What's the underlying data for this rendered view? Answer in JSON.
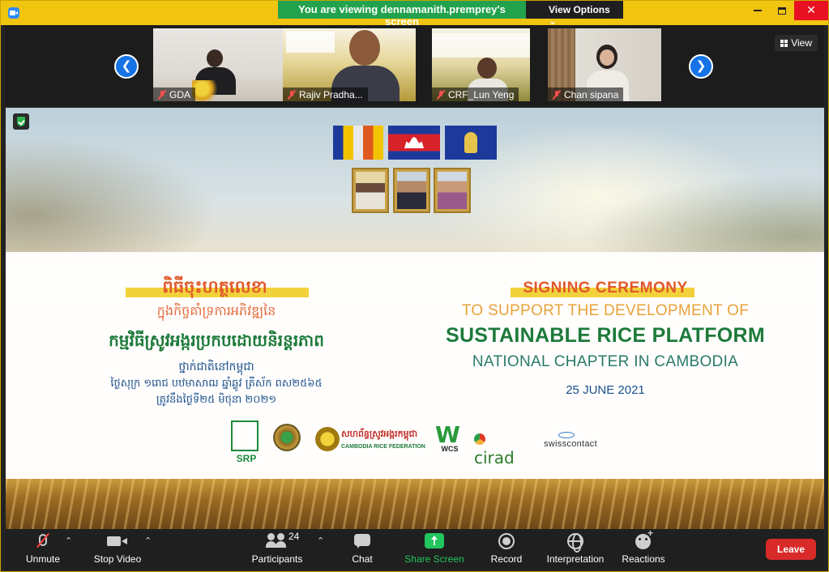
{
  "titlebar": {
    "share_banner": "You are viewing dennamanith.premprey's screen",
    "view_options": "View Options"
  },
  "thumbnails": {
    "view_label": "View",
    "participants": [
      {
        "name": "GDA"
      },
      {
        "name": "Rajiv Pradha..."
      },
      {
        "name": "CRF_Lun Yeng"
      },
      {
        "name": "Chan sipana"
      }
    ]
  },
  "slide": {
    "khmer": {
      "title": "ពិធីចុះហត្ថលេខា",
      "line1": "ក្នុងកិច្ចគាំទ្រការអភិវឌ្ឍនៃ",
      "line2": "កម្មវិធីស្រូវអង្ករប្រកបដោយនិរន្តរភាព",
      "line3": "ថ្នាក់ជាតិនៅកម្ពុជា",
      "line4": "ថ្ងៃសុក្រ ១រោជ បឋមាសាឍ ឆ្នាំឆ្លូវ ត្រីស័ក ពស២៥៦៥",
      "line5": "ត្រូវនឹងថ្ងៃទី២៥ មិថុនា ២០២១"
    },
    "english": {
      "title": "SIGNING CEREMONY",
      "line1": "TO SUPPORT THE DEVELOPMENT OF",
      "line2": "SUSTAINABLE RICE PLATFORM",
      "line3": "NATIONAL CHAPTER IN CAMBODIA",
      "date": "25 JUNE 2021"
    },
    "logos": {
      "srp_label": "SRP",
      "crf_khmer": "សហព័ន្ធស្រូវអង្ករកម្ពុជា",
      "crf_english": "CAMBODIA RICE FEDERATION",
      "wcs_label": "WCS",
      "cirad_label": "cirad",
      "swiss_label": "swisscontact"
    }
  },
  "toolbar": {
    "unmute": "Unmute",
    "stop_video": "Stop Video",
    "participants": "Participants",
    "participant_count": "24",
    "chat": "Chat",
    "share_screen": "Share Screen",
    "record": "Record",
    "interpretation": "Interpretation",
    "reactions": "Reactions",
    "leave": "Leave"
  },
  "colors": {
    "title_bar": "#f1c410",
    "share_green": "#23a24d",
    "slide_green": "#1d7a3a",
    "slide_orange": "#e0582a",
    "slide_blue": "#1a4f8a",
    "leave_red": "#d92a2a"
  }
}
